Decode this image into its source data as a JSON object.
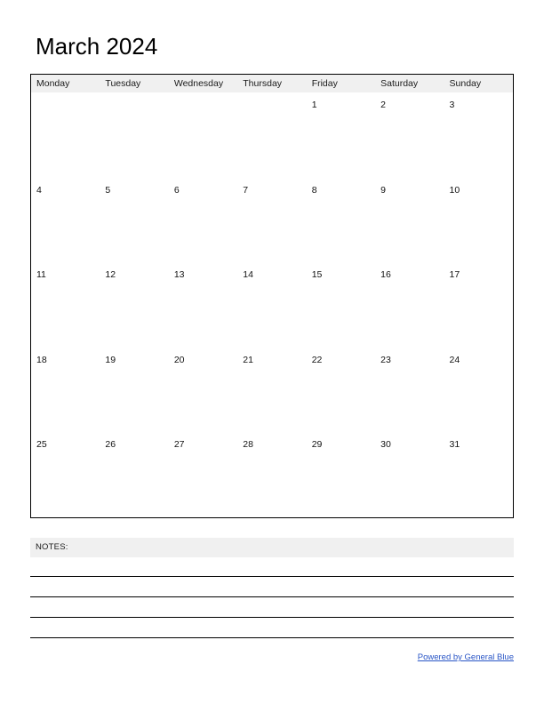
{
  "page": {
    "title": "March 2024",
    "month": "March",
    "year": "2024"
  },
  "calendar": {
    "weekdays": [
      "Monday",
      "Tuesday",
      "Wednesday",
      "Thursday",
      "Friday",
      "Saturday",
      "Sunday"
    ],
    "weeks": [
      [
        "",
        "",
        "",
        "",
        "1",
        "2",
        "3"
      ],
      [
        "4",
        "5",
        "6",
        "7",
        "8",
        "9",
        "10"
      ],
      [
        "11",
        "12",
        "13",
        "14",
        "15",
        "16",
        "17"
      ],
      [
        "18",
        "19",
        "20",
        "21",
        "22",
        "23",
        "24"
      ],
      [
        "25",
        "26",
        "27",
        "28",
        "29",
        "30",
        "31"
      ]
    ]
  },
  "notes": {
    "label": "NOTES:",
    "line_count": 4
  },
  "footer": {
    "link_text": "Powered by General Blue"
  },
  "colors": {
    "header_background": "#f0f0f0",
    "border": "#000000",
    "text": "#000000",
    "link": "#2a56c6",
    "page_background": "#ffffff"
  }
}
